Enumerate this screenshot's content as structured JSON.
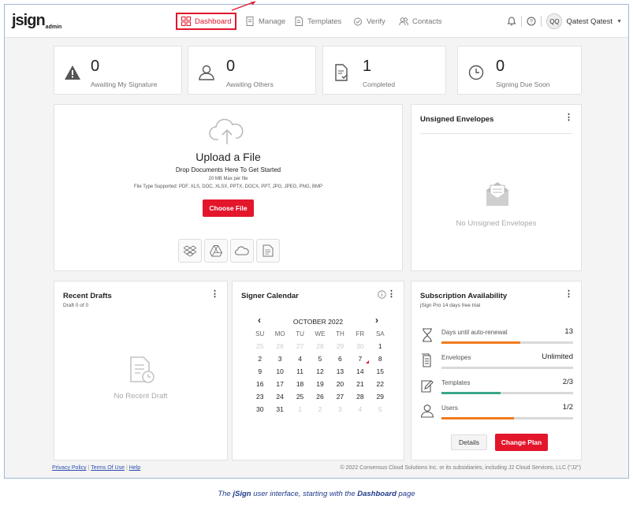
{
  "logo": {
    "text_main": "jsign",
    "text_sub": "admin"
  },
  "nav": {
    "dashboard": "Dashboard",
    "manage": "Manage",
    "templates": "Templates",
    "verify": "Verify",
    "contacts": "Contacts"
  },
  "user": {
    "initials": "QQ",
    "name": "Qatest Qatest"
  },
  "stats": [
    {
      "value": "0",
      "label": "Awaiting My Signature",
      "icon": "warning-icon"
    },
    {
      "value": "0",
      "label": "Awaiting Others",
      "icon": "user-icon"
    },
    {
      "value": "1",
      "label": "Completed",
      "icon": "document-check-icon"
    },
    {
      "value": "0",
      "label": "Signing Due Soon",
      "icon": "clock-icon"
    }
  ],
  "upload": {
    "title": "Upload a File",
    "drop": "Drop Documents Here To Get Started",
    "max": "20 MB Max per file",
    "types": "File Type Supported: PDF, XLS, DOC, XLSX, PPTX, DOCX, PPT, JPG, JPEG, PNG, BMP",
    "button": "Choose File",
    "sources": [
      "dropbox-icon",
      "google-drive-icon",
      "onedrive-icon",
      "document-icon"
    ]
  },
  "unsigned": {
    "title": "Unsigned Envelopes",
    "empty": "No Unsigned Envelopes"
  },
  "drafts": {
    "title": "Recent Drafts",
    "count": "Draft 0 of 0",
    "empty": "No Recent Draft"
  },
  "calendar": {
    "title": "Signer Calendar",
    "month": "OCTOBER 2022",
    "days": [
      "SU",
      "MO",
      "TU",
      "WE",
      "TH",
      "FR",
      "SA"
    ],
    "prev_days": [
      "25",
      "26",
      "27",
      "28",
      "29",
      "30"
    ],
    "dates": [
      "1",
      "2",
      "3",
      "4",
      "5",
      "6",
      "7",
      "8",
      "9",
      "10",
      "11",
      "12",
      "13",
      "14",
      "15",
      "16",
      "17",
      "18",
      "19",
      "20",
      "21",
      "22",
      "23",
      "24",
      "25",
      "26",
      "27",
      "28",
      "29",
      "30",
      "31"
    ],
    "next_days": [
      "1",
      "2",
      "3",
      "4",
      "5"
    ],
    "marked_date": "7"
  },
  "subscription": {
    "title": "Subscription Availability",
    "plan": "jSign Pro 14 days free trial",
    "rows": [
      {
        "label": "Days until auto-renewal",
        "value": "13",
        "fraction": 0.6,
        "color": "#f07c1e",
        "icon": "hourglass-icon"
      },
      {
        "label": "Envelopes",
        "value": "Unlimited",
        "fraction": 0.0,
        "color": "#f07c1e",
        "icon": "envelopes-icon"
      },
      {
        "label": "Templates",
        "value": "2/3",
        "fraction": 0.45,
        "color": "#3aa88a",
        "icon": "template-icon"
      },
      {
        "label": "Users",
        "value": "1/2",
        "fraction": 0.55,
        "color": "#f07c1e",
        "icon": "user-icon"
      }
    ],
    "details_button": "Details",
    "change_button": "Change Plan"
  },
  "footer": {
    "privacy": "Privacy Policy",
    "terms": "Terms Of Use",
    "help": "Help",
    "copyright": "© 2022 Consensus Cloud Solutions Inc. or its subsidiaries, including J2 Cloud Services, LLC (\"J2\")"
  },
  "caption": {
    "pre": "The ",
    "brand": "jSign",
    "mid": " user interface, starting with the ",
    "page": "Dashboard",
    "post": " page"
  },
  "colors": {
    "accent": "#e3162c",
    "orange": "#f07c1e",
    "green": "#3aa88a"
  }
}
